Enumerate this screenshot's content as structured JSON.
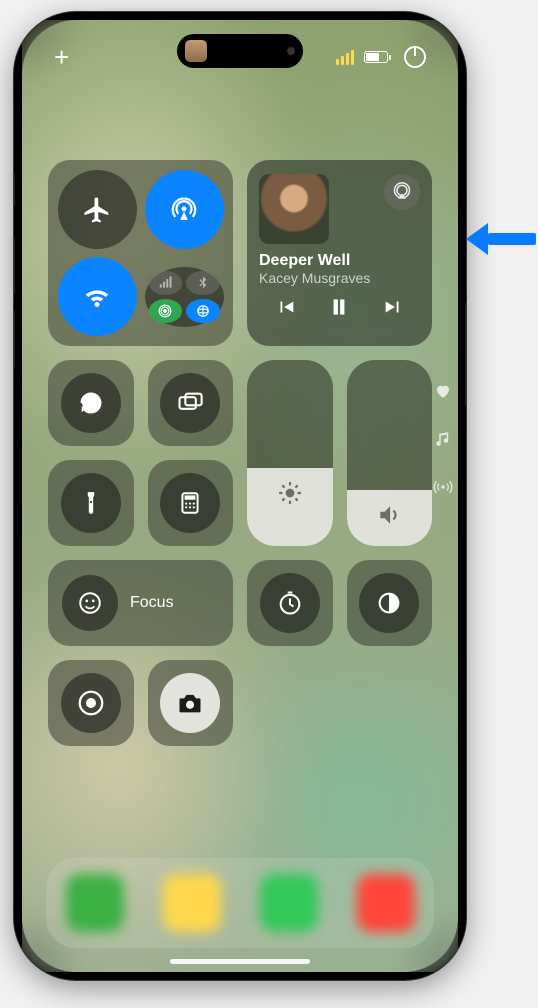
{
  "status": {
    "add_label": "+",
    "battery_level": 60
  },
  "connectivity": {
    "airplane_on": false,
    "airdrop_on": true,
    "wifi_on": true,
    "cellular_on": false,
    "bluetooth_on": false,
    "hotspot_on": true
  },
  "media": {
    "track": "Deeper Well",
    "artist": "Kacey Musgraves",
    "playing": false
  },
  "sliders": {
    "brightness_pct": 42,
    "volume_pct": 30
  },
  "focus": {
    "label": "Focus"
  },
  "page_indicators": [
    "favorite",
    "music",
    "broadcast"
  ]
}
